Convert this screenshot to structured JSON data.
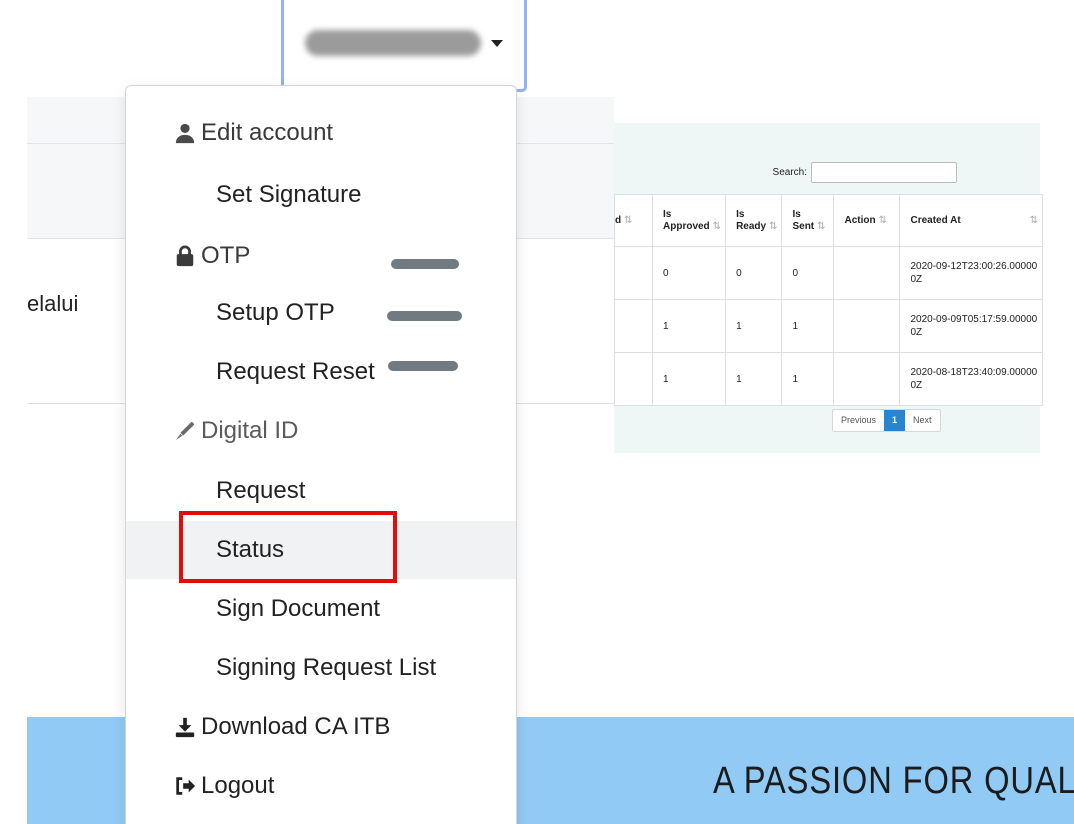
{
  "user": {
    "name_redacted": true
  },
  "background_page": {
    "fragment_text": "elalui"
  },
  "menu": {
    "edit_account": {
      "label": "Edit account",
      "icon": "user-icon"
    },
    "set_signature": {
      "label": "Set Signature"
    },
    "otp": {
      "label": "OTP",
      "icon": "lock-icon"
    },
    "setup_otp": {
      "label": "Setup OTP"
    },
    "request_reset": {
      "label": "Request Reset"
    },
    "digital_id": {
      "label": "Digital ID",
      "icon": "pen-icon"
    },
    "request": {
      "label": "Request"
    },
    "status": {
      "label": "Status"
    },
    "sign_document": {
      "label": "Sign Document"
    },
    "signing_request_list": {
      "label": "Signing Request List"
    },
    "download_ca": {
      "label": "Download CA ITB",
      "icon": "download-icon"
    },
    "logout": {
      "label": "Logout",
      "icon": "sign-out-icon"
    }
  },
  "table_panel": {
    "search_label": "Search:",
    "search_value": "",
    "columns": [
      "d",
      "Is Approved",
      "Is Ready",
      "Is Sent",
      "Action",
      "Created At"
    ],
    "rows": [
      {
        "d": "",
        "is_approved": "0",
        "is_ready": "0",
        "is_sent": "0",
        "action": "",
        "created_at": "2020-09-12T23:00:26.000000Z"
      },
      {
        "d": "",
        "is_approved": "1",
        "is_ready": "1",
        "is_sent": "1",
        "action": "",
        "created_at": "2020-09-09T05:17:59.000000Z"
      },
      {
        "d": "",
        "is_approved": "1",
        "is_ready": "1",
        "is_sent": "1",
        "action": "",
        "created_at": "2020-08-18T23:40:09.000000Z"
      }
    ],
    "pagination": {
      "previous": "Previous",
      "current": "1",
      "next": "Next"
    }
  },
  "banner": {
    "tagline": "A PASSION FOR QUALIT"
  },
  "colors": {
    "highlight": "#e00d0d",
    "banner": "#90caf5",
    "pager_active": "#2785d2",
    "toggle_border": "#8fb4f3"
  }
}
